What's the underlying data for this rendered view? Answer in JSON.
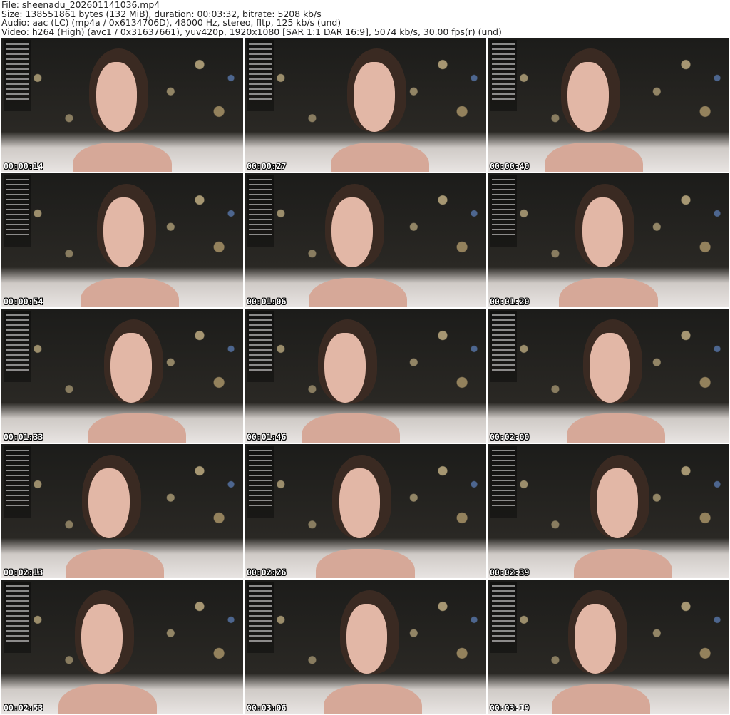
{
  "header": {
    "file": "File: sheenadu_202601141036.mp4",
    "size": "Size: 138551861 bytes (132 MiB), duration: 00:03:32, bitrate: 5208 kb/s",
    "audio": "Audio: aac (LC) (mp4a / 0x6134706D), 48000 Hz, stereo, fltp, 125 kb/s (und)",
    "video": "Video: h264 (High) (avc1 / 0x31637661), yuv420p, 1920x1080 [SAR 1:1 DAR 16:9], 5074 kb/s, 30.00 fps(r) (und)"
  },
  "thumbnails": [
    {
      "time": "00:00:14"
    },
    {
      "time": "00:00:27"
    },
    {
      "time": "00:00:40"
    },
    {
      "time": "00:00:54"
    },
    {
      "time": "00:01:06"
    },
    {
      "time": "00:01:20"
    },
    {
      "time": "00:01:33"
    },
    {
      "time": "00:01:46"
    },
    {
      "time": "00:02:00"
    },
    {
      "time": "00:02:13"
    },
    {
      "time": "00:02:26"
    },
    {
      "time": "00:02:39"
    },
    {
      "time": "00:02:53"
    },
    {
      "time": "00:03:06"
    },
    {
      "time": "00:03:19"
    }
  ]
}
